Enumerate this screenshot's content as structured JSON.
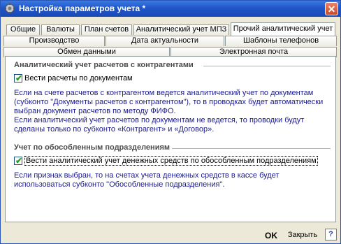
{
  "window": {
    "title": "Настройка параметров учета *"
  },
  "tabs": {
    "row1": [
      "Общие",
      "Валюты",
      "План счетов",
      "Аналитический учет МПЗ",
      "Прочий аналитический учет"
    ],
    "row2": [
      "Производство",
      "Дата актуальности",
      "Шаблоны телефонов"
    ],
    "row3": [
      "Обмен данными",
      "Электронная почта"
    ]
  },
  "section1": {
    "title": "Аналитический учет расчетов с контрагентами",
    "checkbox_label": "Вести расчеты по документам",
    "checked": true,
    "desc": [
      "Если на счете расчетов с контрагентом ведется аналитический учет по документам",
      "(субконто \"Документы расчетов с контрагентом\"), то в проводках будет автоматически",
      "выбран  документ расчетов по методу ФИФО.",
      "Если аналитический учет расчетов по документам не ведется, то проводки будут",
      "сделаны только по субконто «Контрагент» и «Договор»."
    ]
  },
  "section2": {
    "title": "Учет по обособленным подразделениям",
    "checkbox_label": "Вести аналитический учет денежных средств по обособленным подразделениям",
    "checked": true,
    "desc": [
      "Если признак выбран, то на счетах учета денежных средств в кассе будет",
      "использоваться субконто \"Обособленные подразделения\"."
    ]
  },
  "footer": {
    "ok": "OK",
    "close": "Закрыть",
    "help": "?"
  },
  "icons": {
    "title": "gear-icon",
    "close": "close-icon",
    "check": "checkmark-icon"
  },
  "colors": {
    "titlebar": "#1f56c8",
    "description_text": "#1b1b8f",
    "check": "#21a121"
  }
}
